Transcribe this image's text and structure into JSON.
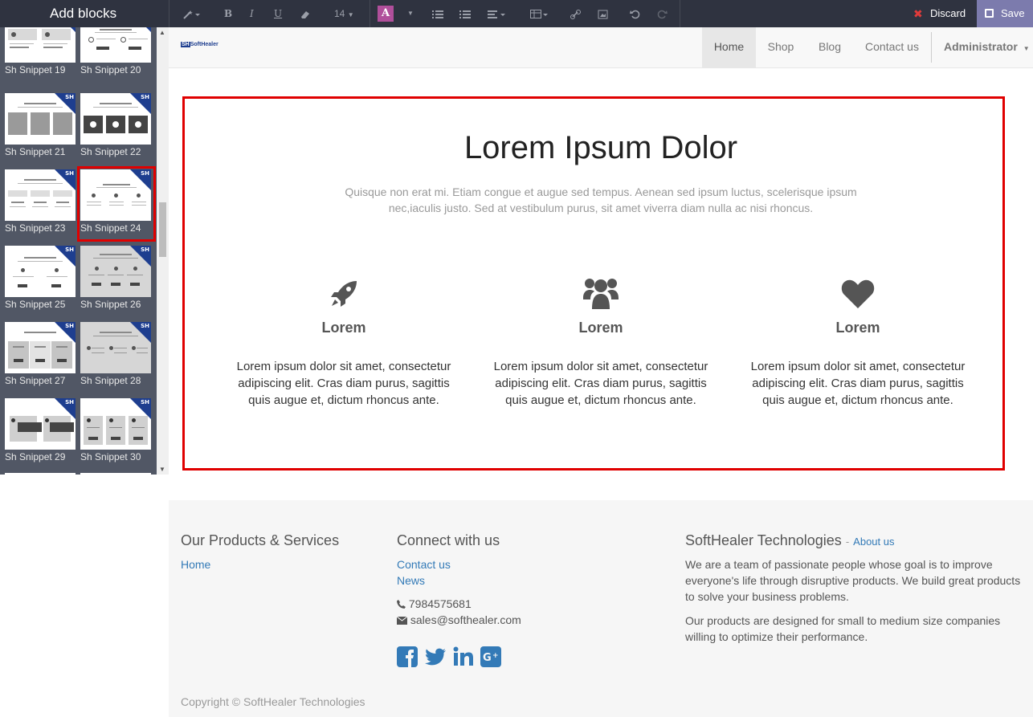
{
  "sidebar": {
    "title": "Add blocks",
    "snippets": [
      {
        "label": "Sh Snippet 19"
      },
      {
        "label": "Sh Snippet 20"
      },
      {
        "label": "Sh Snippet 21"
      },
      {
        "label": "Sh Snippet 22"
      },
      {
        "label": "Sh Snippet 23"
      },
      {
        "label": "Sh Snippet 24"
      },
      {
        "label": "Sh Snippet 25"
      },
      {
        "label": "Sh Snippet 26"
      },
      {
        "label": "Sh Snippet 27"
      },
      {
        "label": "Sh Snippet 28"
      },
      {
        "label": "Sh Snippet 29"
      },
      {
        "label": "Sh Snippet 30"
      }
    ],
    "badge_text": "SH",
    "selected_snippet": "Sh Snippet 24"
  },
  "toolbar": {
    "font_size": "14",
    "color_button_letter": "A",
    "bold": "B",
    "italic": "I",
    "underline": "U",
    "discard_label": "Discard",
    "save_label": "Save"
  },
  "nav": {
    "logo_text": "SoftHealer",
    "items": [
      "Home",
      "Shop",
      "Blog",
      "Contact us"
    ],
    "active": "Home",
    "user": "Administrator"
  },
  "hero": {
    "title": "Lorem Ipsum Dolor",
    "subtitle": "Quisque non erat mi. Etiam congue et augue sed tempus. Aenean sed ipsum luctus, scelerisque ipsum nec,iaculis justo. Sed at vestibulum purus, sit amet viverra diam nulla ac nisi rhoncus."
  },
  "features": [
    {
      "icon": "rocket-icon",
      "title": "Lorem",
      "text": "Lorem ipsum dolor sit amet, consectetur adipiscing elit. Cras diam purus, sagittis quis augue et, dictum rhoncus ante."
    },
    {
      "icon": "users-icon",
      "title": "Lorem",
      "text": "Lorem ipsum dolor sit amet, consectetur adipiscing elit. Cras diam purus, sagittis quis augue et, dictum rhoncus ante."
    },
    {
      "icon": "heart-icon",
      "title": "Lorem",
      "text": "Lorem ipsum dolor sit amet, consectetur adipiscing elit. Cras diam purus, sagittis quis augue et, dictum rhoncus ante."
    }
  ],
  "footer": {
    "products": {
      "heading": "Our Products & Services",
      "links": [
        "Home"
      ]
    },
    "connect": {
      "heading": "Connect with us",
      "links": [
        "Contact us",
        "News"
      ],
      "phone": "7984575681",
      "email": "sales@softhealer.com",
      "social": [
        "facebook-icon",
        "twitter-icon",
        "linkedin-icon",
        "google-plus-icon"
      ]
    },
    "about": {
      "heading": "SoftHealer Technologies",
      "link_prefix": "-",
      "link": "About us",
      "para1": "We are a team of passionate people whose goal is to improve everyone's life through disruptive products. We build great products to solve your business problems.",
      "para2": "Our products are designed for small to medium size companies willing to optimize their performance."
    },
    "copyright": "Copyright © SoftHealer Technologies"
  },
  "colors": {
    "toolbar_bg": "#2f3340",
    "sidebar_bg": "#515765",
    "save_bg": "#7c7bad",
    "highlight": "#e00000",
    "link": "#337ab7",
    "badge": "#1e3e8f"
  }
}
